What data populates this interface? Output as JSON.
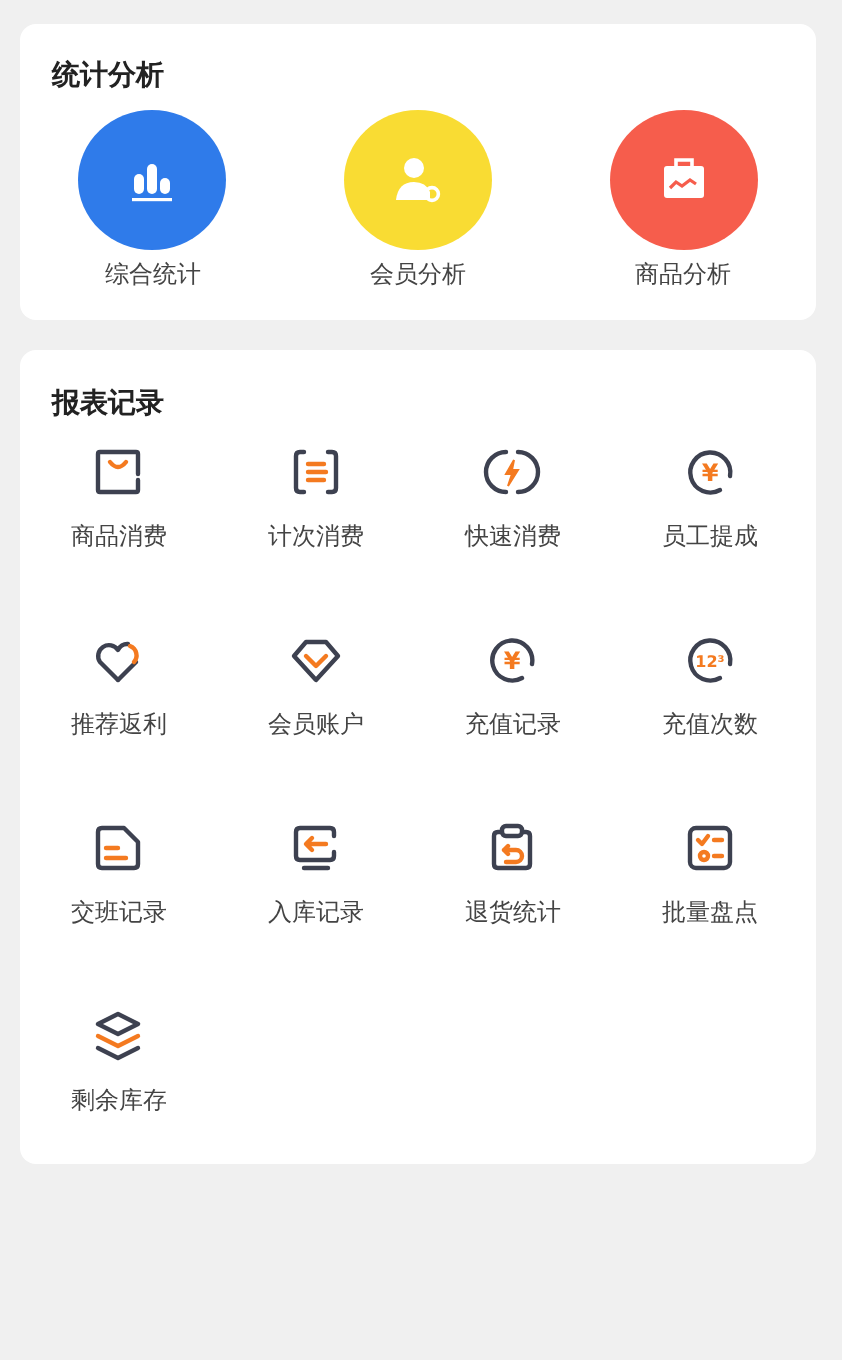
{
  "stats": {
    "title": "统计分析",
    "items": [
      {
        "label": "综合统计",
        "kind": "bars",
        "color": "#2f7bea"
      },
      {
        "label": "会员分析",
        "kind": "member",
        "color": "#f9dc33"
      },
      {
        "label": "商品分析",
        "kind": "case",
        "color": "#f65d4c"
      }
    ]
  },
  "reports": {
    "title": "报表记录",
    "items": [
      {
        "label": "商品消费",
        "kind": "bag"
      },
      {
        "label": "计次消费",
        "kind": "list"
      },
      {
        "label": "快速消费",
        "kind": "bolt"
      },
      {
        "label": "员工提成",
        "kind": "coin",
        "glyph": "¥"
      },
      {
        "label": "推荐返利",
        "kind": "heart"
      },
      {
        "label": "会员账户",
        "kind": "gem"
      },
      {
        "label": "充值记录",
        "kind": "coin",
        "glyph": "¥"
      },
      {
        "label": "充值次数",
        "kind": "coin",
        "glyph": "12³"
      },
      {
        "label": "交班记录",
        "kind": "doc"
      },
      {
        "label": "入库记录",
        "kind": "monitor"
      },
      {
        "label": "退货统计",
        "kind": "clip"
      },
      {
        "label": "批量盘点",
        "kind": "check"
      },
      {
        "label": "剩余库存",
        "kind": "layers"
      }
    ]
  }
}
